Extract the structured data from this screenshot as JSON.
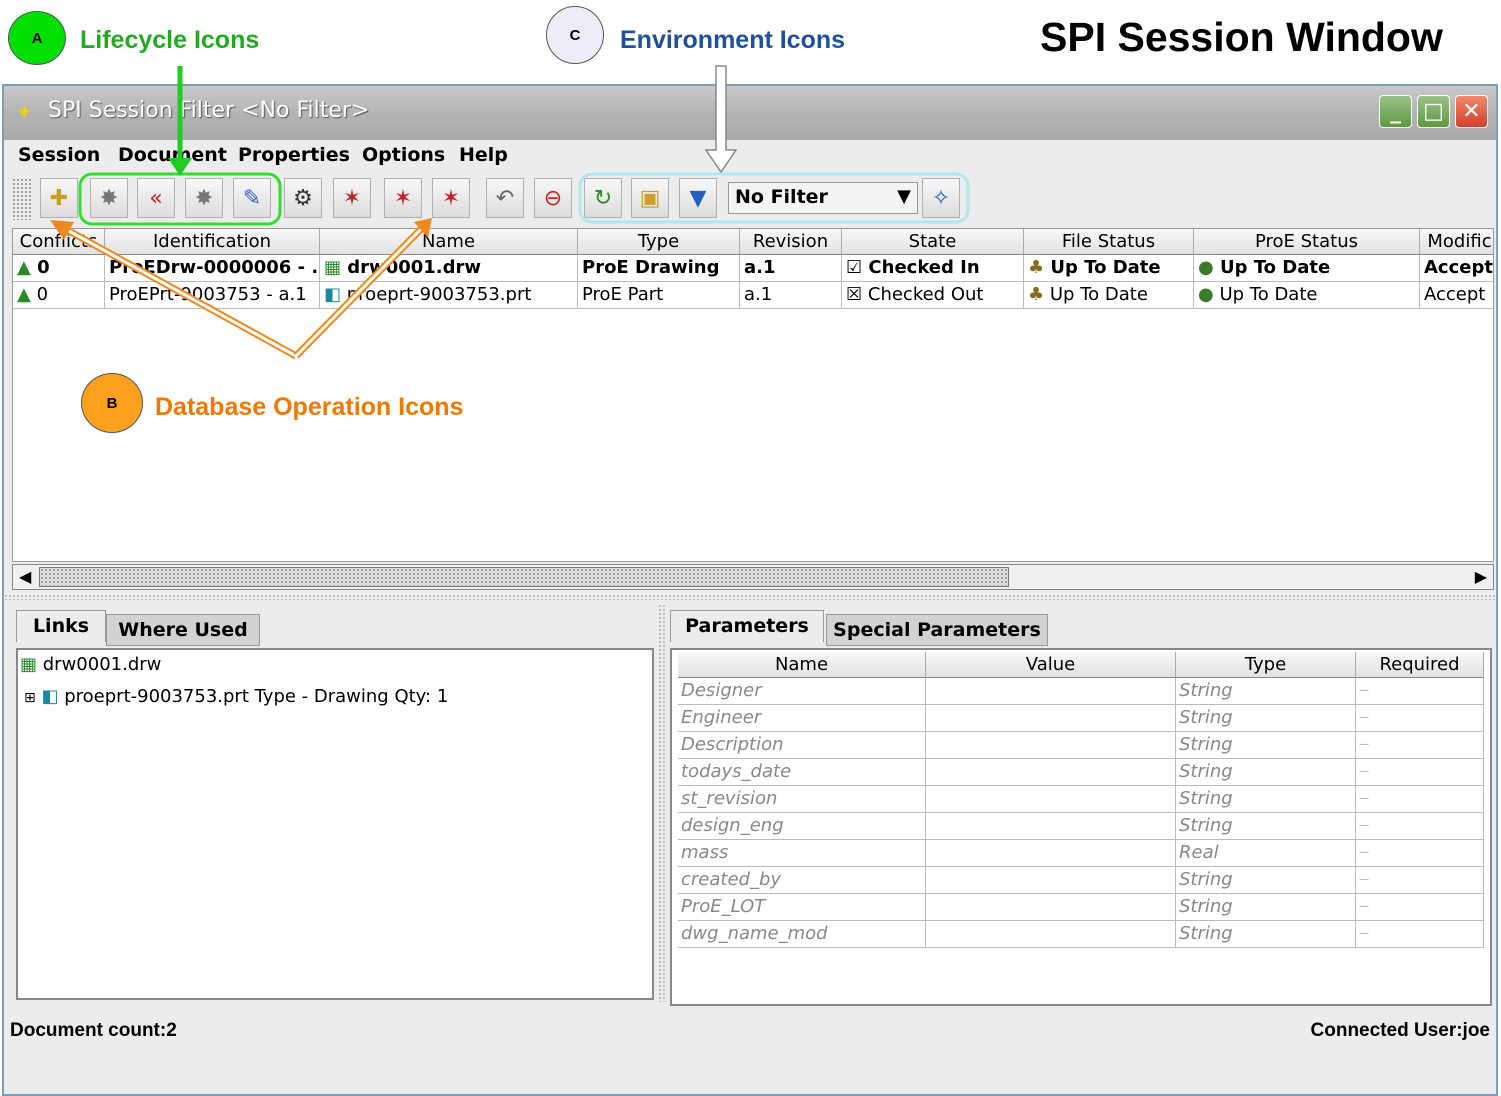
{
  "annotations": {
    "a": {
      "letter": "A",
      "label": "Lifecycle Icons",
      "fill": "#00e000",
      "color": "#22aa22"
    },
    "b": {
      "letter": "B",
      "label": "Database Operation Icons",
      "fill": "#ffa020",
      "color": "#f07800"
    },
    "c": {
      "letter": "C",
      "label": "Environment Icons",
      "fill": "#ecedf8",
      "color": "#1f4f9f"
    },
    "heading": "SPI Session Window"
  },
  "window": {
    "title": "SPI Session Filter <No Filter>",
    "buttons": {
      "minimize": "_",
      "maximize": "□",
      "close": "✕"
    }
  },
  "menu": [
    "Session",
    "Document",
    "Properties",
    "Options",
    "Help"
  ],
  "toolbar": {
    "filter_value": "No Filter",
    "icons": [
      "new-document-icon",
      "lifecycle-promote-icon",
      "lifecycle-demote-icon",
      "lifecycle-hold-icon",
      "lifecycle-review-icon",
      "db-attach-icon",
      "db-checkout-icon",
      "db-checkin-icon",
      "db-checkin-all-icon",
      "db-undo-icon",
      "db-delete-icon",
      "env-refresh-icon",
      "env-workspace-icon",
      "env-filter-icon",
      "env-settings-icon"
    ]
  },
  "grid": {
    "columns": [
      "Conflicts",
      "Identification",
      "Name",
      "Type",
      "Revision",
      "State",
      "File Status",
      "ProE Status",
      "Modific"
    ],
    "rows": [
      {
        "conflicts": "0",
        "identification": "ProEDrw-0000006 - ...",
        "name": "drw0001.drw",
        "type": "ProE Drawing",
        "revision": "a.1",
        "state": "Checked In",
        "file_status": "Up To Date",
        "proe_status": "Up To Date",
        "modified": "Accept",
        "bold": true
      },
      {
        "conflicts": "0",
        "identification": "ProEPrt-9003753 - a.1",
        "name": "proeprt-9003753.prt",
        "type": "ProE Part",
        "revision": "a.1",
        "state": "Checked Out",
        "file_status": "Up To Date",
        "proe_status": "Up To Date",
        "modified": "Accept",
        "bold": false
      }
    ]
  },
  "left_tabs": [
    "Links",
    "Where Used"
  ],
  "links_tree": {
    "root": "drw0001.drw",
    "child": "proeprt-9003753.prt Type - Drawing Qty: 1"
  },
  "right_tabs": [
    "Parameters",
    "Special Parameters"
  ],
  "parameters": {
    "columns": [
      "Name",
      "Value",
      "Type",
      "Required"
    ],
    "rows": [
      {
        "name": "Designer",
        "value": "",
        "type": "String",
        "required": "—"
      },
      {
        "name": "Engineer",
        "value": "",
        "type": "String",
        "required": "—"
      },
      {
        "name": "Description",
        "value": "",
        "type": "String",
        "required": "—"
      },
      {
        "name": "todays_date",
        "value": "",
        "type": "String",
        "required": "—"
      },
      {
        "name": "st_revision",
        "value": "",
        "type": "String",
        "required": "—"
      },
      {
        "name": "design_eng",
        "value": "",
        "type": "String",
        "required": "—"
      },
      {
        "name": "mass",
        "value": "",
        "type": "Real",
        "required": "—"
      },
      {
        "name": "created_by",
        "value": "",
        "type": "String",
        "required": "—"
      },
      {
        "name": "ProE_LOT",
        "value": "",
        "type": "String",
        "required": "—"
      },
      {
        "name": "dwg_name_mod",
        "value": "",
        "type": "String",
        "required": "—"
      }
    ]
  },
  "status_bar": {
    "left": "Document count:2",
    "right": "Connected User:joe"
  }
}
